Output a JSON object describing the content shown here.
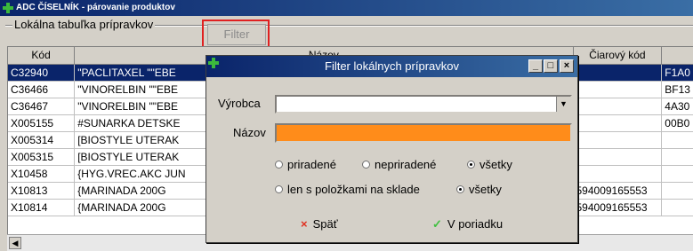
{
  "window": {
    "title": "ADC ČÍSELNÍK - párovanie produktov"
  },
  "toolbar": {
    "group_label": "Lokálna tabuľka prípravkov",
    "filter_label": "Filter"
  },
  "grid": {
    "columns": [
      "Kód",
      "Názov",
      "Čiarový kód",
      ""
    ],
    "rows": [
      [
        "C32940",
        "\"PACLITAXEL \"\"EBE",
        "",
        "F1A0"
      ],
      [
        "C36466",
        "\"VINORELBIN \"\"EBE",
        "",
        "BF13"
      ],
      [
        "C36467",
        "\"VINORELBIN \"\"EBE",
        "",
        "4A30"
      ],
      [
        "X005155",
        "#SUNARKA DETSKE",
        "",
        "00B0"
      ],
      [
        "X005314",
        "[BIOSTYLE UTERAK",
        "",
        ""
      ],
      [
        "X005315",
        "[BIOSTYLE UTERAK",
        "",
        ""
      ],
      [
        "X10458",
        "{HYG.VREC.AKC JUN",
        "",
        ""
      ],
      [
        "X10813",
        "{MARINADA 200G",
        "594009165553",
        ""
      ],
      [
        "X10814",
        "{MARINADA 200G",
        "594009165553",
        ""
      ]
    ]
  },
  "dialog": {
    "title": "Filter lokálnych prípravkov",
    "manufacturer_label": "Výrobca",
    "manufacturer_value": "",
    "name_label": "Názov",
    "name_value": "",
    "radio1": {
      "a": "priradené",
      "b": "nepriradené",
      "c": "všetky",
      "selected": "všetky"
    },
    "radio2": {
      "a": "len s položkami na sklade",
      "b": "všetky",
      "selected": "všetky"
    },
    "back_label": "Späť",
    "ok_label": "V poriadku"
  },
  "colors": {
    "title_start": "#0a246a",
    "title_end": "#3a6ea5",
    "selected_row": "#0a246a",
    "name_field": "#ff8c1a"
  }
}
